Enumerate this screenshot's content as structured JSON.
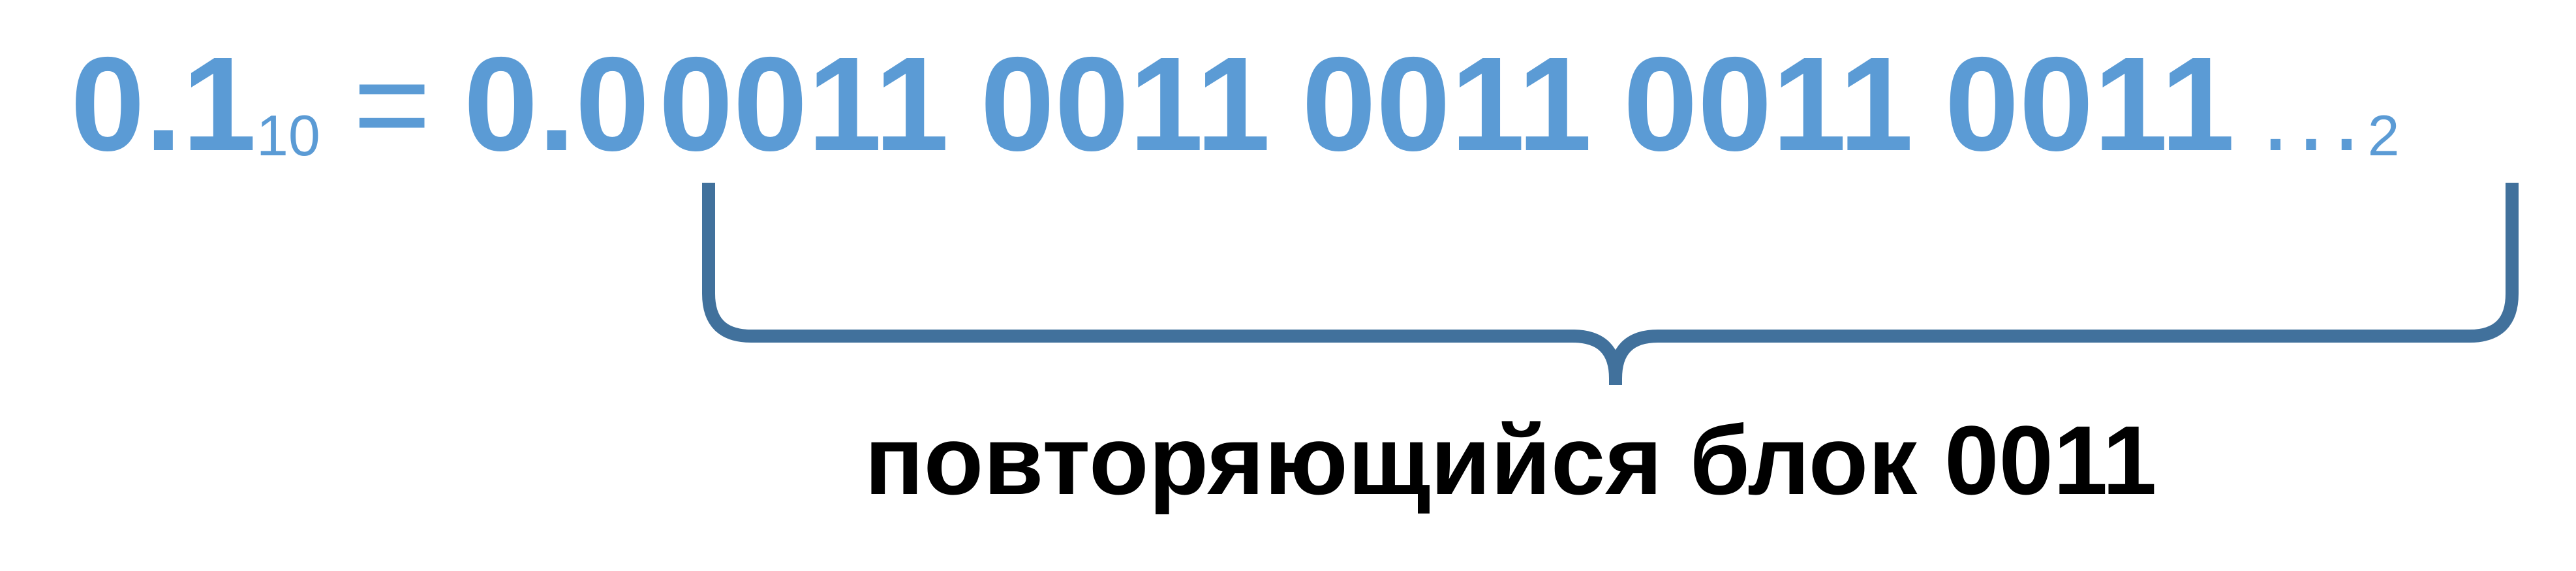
{
  "formula": {
    "lhs_value": "0.1",
    "lhs_base": "10",
    "equals": "=",
    "prefix": "0.0",
    "groups": [
      "0011",
      "0011",
      "0011",
      "0011",
      "0011"
    ],
    "ellipsis": "...",
    "rhs_base": "2"
  },
  "annotation": {
    "caption": "повторяющийся блок 0011"
  },
  "colors": {
    "number_blue": "#5b9bd5",
    "brace_blue": "#41719c",
    "caption_black": "#000000"
  }
}
